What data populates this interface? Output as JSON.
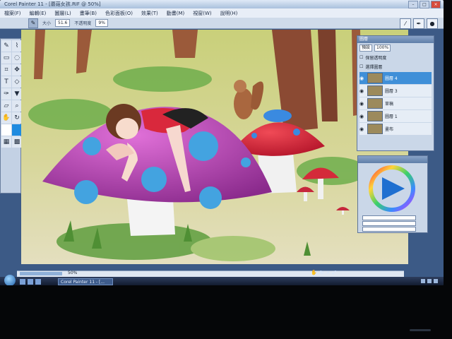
{
  "window": {
    "title": "Corel Painter 11 - [蘑菇女孩.RIF @ 50%]",
    "buttons": [
      "minimize",
      "maximize",
      "close"
    ]
  },
  "menubar": [
    "檔案(F)",
    "編輯(E)",
    "圖層(L)",
    "畫筆(B)",
    "色彩面板(O)",
    "效果(T)",
    "動畫(M)",
    "視窗(W)",
    "說明(H)"
  ],
  "property_bar": {
    "size_label": "大小",
    "size_value": "51.6",
    "opacity_label": "不透明度",
    "opacity_value": "9%"
  },
  "toolbox": {
    "tools": [
      "brush-tool",
      "dropper-tool",
      "selection-tool",
      "lasso-tool",
      "crop-tool",
      "transform-tool",
      "text-tool",
      "shape-tool",
      "pen-tool",
      "fill-tool",
      "eraser-tool",
      "magnifier-tool",
      "grabber-tool",
      "rotate-tool"
    ]
  },
  "layers_panel": {
    "title": "圖層",
    "composite_method": "預設",
    "preserve_label": "保留透明度",
    "pick_label": "選擇圖層",
    "opacity": "100%",
    "layers": [
      {
        "name": "圖層 4",
        "active": true
      },
      {
        "name": "圖層 3",
        "active": false
      },
      {
        "name": "草稿",
        "active": false
      },
      {
        "name": "圖層 1",
        "active": false
      },
      {
        "name": "畫布",
        "active": false
      }
    ]
  },
  "color_panel": {
    "primary": "#1f6fd0",
    "secondary": "#ffffff"
  },
  "status": {
    "zoom": "50%"
  },
  "taskbar": {
    "active_task": "Corel Painter 11 - [..."
  },
  "colors": {
    "screen_bg": "#3c5a86",
    "accent": "#3f8fd8"
  }
}
